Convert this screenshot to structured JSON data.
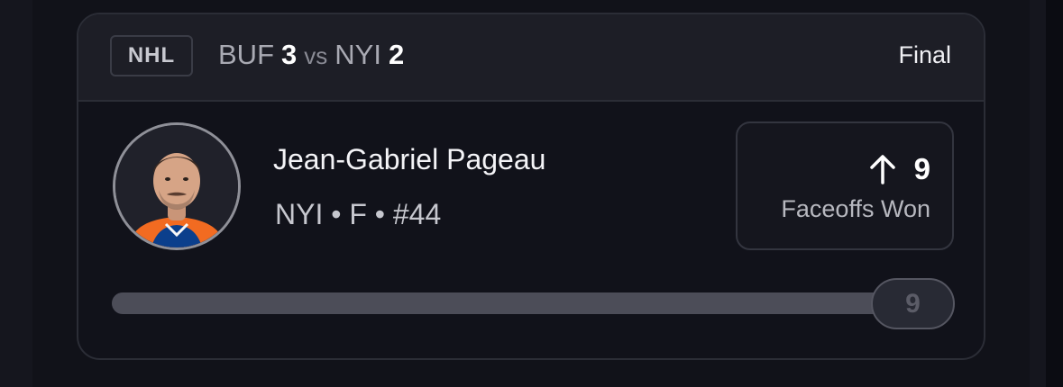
{
  "game": {
    "league": "NHL",
    "away_team": "BUF",
    "away_score": "3",
    "vs_label": "vs",
    "home_team": "NYI",
    "home_score": "2",
    "status": "Final"
  },
  "player": {
    "name": "Jean-Gabriel Pageau",
    "meta": "NYI • F • #44",
    "avatar_icon": "player-headshot"
  },
  "stat": {
    "value": "9",
    "label": "Faceoffs Won",
    "trend_icon": "arrow-up-icon"
  },
  "progress": {
    "value_label": "9",
    "fraction": 1.0
  },
  "colors": {
    "background": "#0b0c12",
    "card": "#11121a",
    "header": "#1d1e26",
    "jersey_orange": "#f26b21",
    "jersey_blue": "#0b3f8c"
  }
}
